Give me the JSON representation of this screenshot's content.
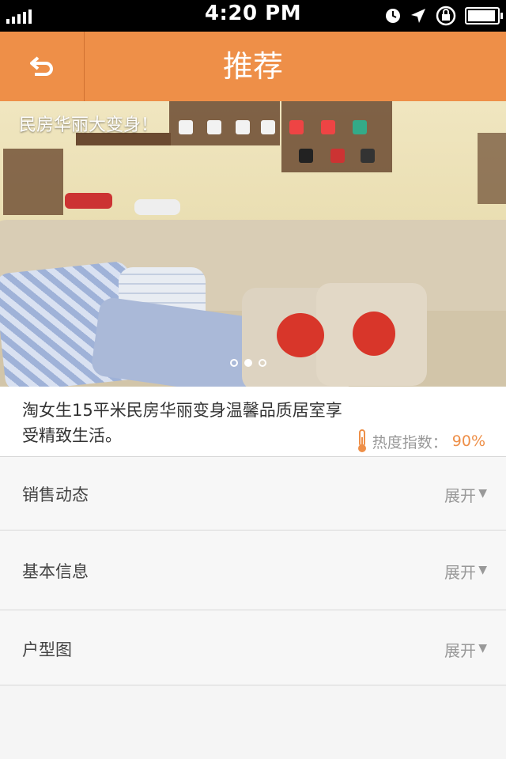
{
  "status": {
    "time": "4:20 PM"
  },
  "nav": {
    "title": "推荐"
  },
  "banner": {
    "caption": "民房华丽大变身！",
    "page_count": 3,
    "active_page": 2
  },
  "description": {
    "text": "淘女生15平米民房华丽变身温馨品质居室享受精致生活。",
    "heat_label": "热度指数：",
    "heat_value": "90%"
  },
  "sections": [
    {
      "label": "销售动态",
      "action": "展开"
    },
    {
      "label": "基本信息",
      "action": "展开"
    },
    {
      "label": "户型图",
      "action": "展开"
    }
  ],
  "colors": {
    "accent": "#ee8f48"
  }
}
